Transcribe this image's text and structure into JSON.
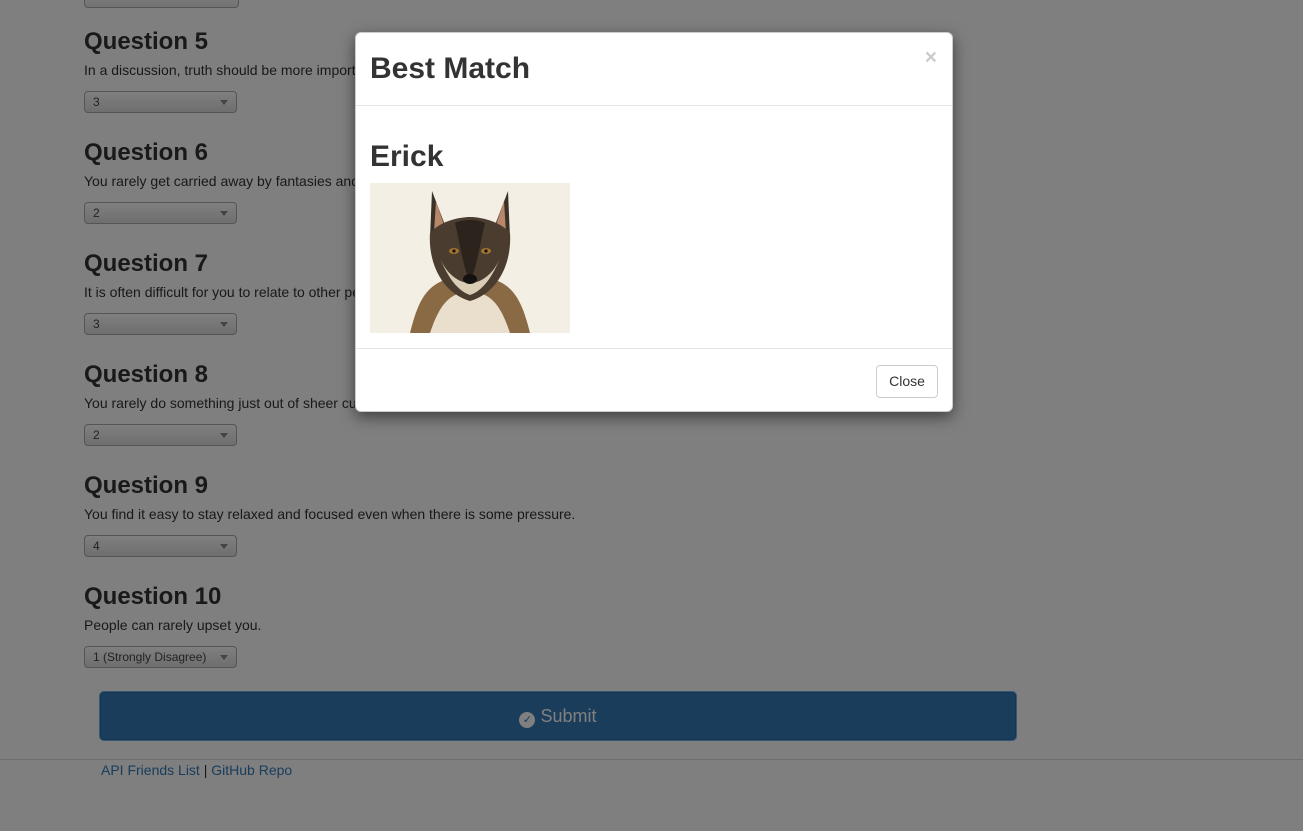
{
  "questions": [
    {
      "title": "Question 5",
      "text": "In a discussion, truth should be more important than considerations of others.",
      "value": "3"
    },
    {
      "title": "Question 6",
      "text": "You rarely get carried away by fantasies and ideas.",
      "value": "2"
    },
    {
      "title": "Question 7",
      "text": "It is often difficult for you to relate to other people's feelings.",
      "value": "3"
    },
    {
      "title": "Question 8",
      "text": "You rarely do something just out of sheer curiosity.",
      "value": "2"
    },
    {
      "title": "Question 9",
      "text": "You find it easy to stay relaxed and focused even when there is some pressure.",
      "value": "4"
    },
    {
      "title": "Question 10",
      "text": "People can rarely upset you.",
      "value": "1 (Strongly Disagree)"
    }
  ],
  "submit": {
    "label": "Submit",
    "icon": "check-circle-icon",
    "color": "#337ab7"
  },
  "footer": {
    "link1": "API Friends List",
    "separator": "|",
    "link2": "GitHub Repo"
  },
  "modal": {
    "title": "Best Match",
    "close_x": "×",
    "match_name": "Erick",
    "photo_alt": "wolf-dog photo",
    "close_label": "Close"
  }
}
